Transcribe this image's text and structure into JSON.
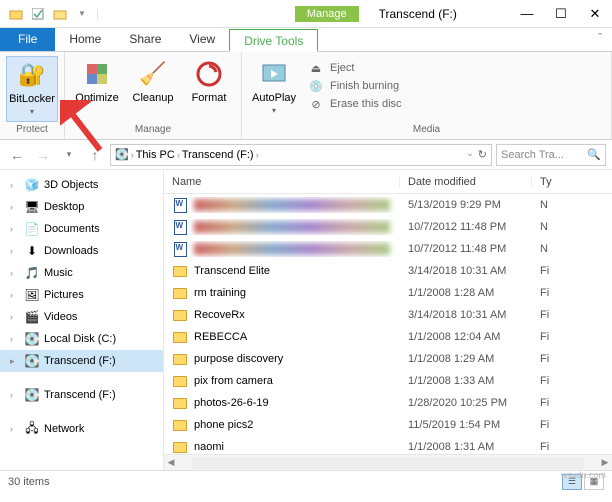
{
  "window": {
    "title": "Transcend (F:)",
    "manage": "Manage",
    "items_count": "30 items"
  },
  "tabs": {
    "file": "File",
    "home": "Home",
    "share": "Share",
    "view": "View",
    "drivetools": "Drive Tools"
  },
  "ribbon": {
    "protect": {
      "label": "Protect",
      "bitlocker": "BitLocker"
    },
    "manage": {
      "label": "Manage",
      "optimize": "Optimize",
      "cleanup": "Cleanup",
      "format": "Format"
    },
    "media": {
      "label": "Media",
      "autoplay": "AutoPlay",
      "eject": "Eject",
      "finish": "Finish burning",
      "erase": "Erase this disc"
    }
  },
  "addr": {
    "thispc": "This PC",
    "drive": "Transcend (F:)"
  },
  "search": {
    "placeholder": "Search Tra..."
  },
  "nav": {
    "items": [
      {
        "label": "3D Objects",
        "icon": "🧊"
      },
      {
        "label": "Desktop",
        "icon": "🖥"
      },
      {
        "label": "Documents",
        "icon": "📄"
      },
      {
        "label": "Downloads",
        "icon": "⬇"
      },
      {
        "label": "Music",
        "icon": "🎵"
      },
      {
        "label": "Pictures",
        "icon": "🖼"
      },
      {
        "label": "Videos",
        "icon": "🎬"
      },
      {
        "label": "Local Disk (C:)",
        "icon": "💽"
      },
      {
        "label": "Transcend (F:)",
        "icon": "💽"
      }
    ],
    "drive2": "Transcend (F:)",
    "network": "Network"
  },
  "columns": {
    "name": "Name",
    "date": "Date modified",
    "type": "Ty"
  },
  "files": [
    {
      "name": "",
      "type": "doc",
      "blur": true,
      "date": "5/13/2019 9:29 PM",
      "ty": "N"
    },
    {
      "name": "",
      "type": "doc",
      "blur": true,
      "date": "10/7/2012 11:48 PM",
      "ty": "N"
    },
    {
      "name": "",
      "type": "doc",
      "blur": true,
      "date": "10/7/2012 11:48 PM",
      "ty": "N"
    },
    {
      "name": "Transcend Elite",
      "type": "folder",
      "date": "3/14/2018 10:31 AM",
      "ty": "Fi"
    },
    {
      "name": "rm training",
      "type": "folder",
      "date": "1/1/2008 1:28 AM",
      "ty": "Fi"
    },
    {
      "name": "RecoveRx",
      "type": "folder",
      "date": "3/14/2018 10:31 AM",
      "ty": "Fi"
    },
    {
      "name": "REBECCA",
      "type": "folder",
      "date": "1/1/2008 12:04 AM",
      "ty": "Fi"
    },
    {
      "name": "purpose discovery",
      "type": "folder",
      "date": "1/1/2008 1:29 AM",
      "ty": "Fi"
    },
    {
      "name": "pix from camera",
      "type": "folder",
      "date": "1/1/2008 1:33 AM",
      "ty": "Fi"
    },
    {
      "name": "photos-26-6-19",
      "type": "folder",
      "date": "1/28/2020 10:25 PM",
      "ty": "Fi"
    },
    {
      "name": "phone pics2",
      "type": "folder",
      "date": "11/5/2019 1:54 PM",
      "ty": "Fi"
    },
    {
      "name": "naomi",
      "type": "folder",
      "date": "1/1/2008 1:31 AM",
      "ty": "Fi"
    }
  ],
  "watermark": "wsxdn.com"
}
